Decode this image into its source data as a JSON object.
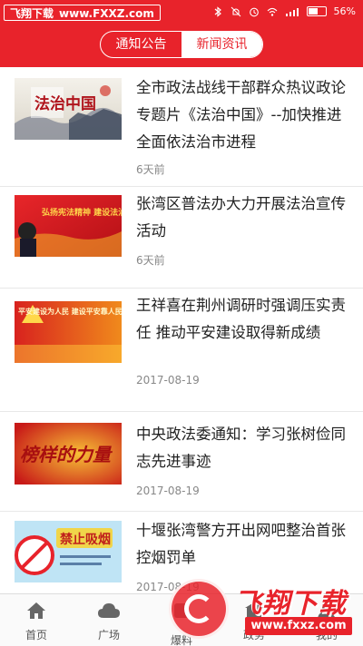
{
  "status_bar": {
    "watermark_brand": "飞翔下载",
    "watermark_url": "www.FXXZ.com",
    "battery": "56%",
    "battery_level": 0.56
  },
  "tabs": [
    {
      "label": "通知公告",
      "active": false
    },
    {
      "label": "新闻资讯",
      "active": true
    }
  ],
  "news": [
    {
      "title": "全市政法战线干部群众热议政论专题片《法治中国》--加快推进全面依法治市进程",
      "date": "6天前",
      "thumb_caption": "法治中国"
    },
    {
      "title": "张湾区普法办大力开展法治宣传活动",
      "date": "6天前",
      "thumb_caption": "弘扬宪法精神 建设法治中国"
    },
    {
      "title": "王祥喜在荆州调研时强调压实责任 推动平安建设取得新成绩",
      "date": "2017-08-19",
      "thumb_caption": "平安建设为人民 建设平安靠人民 平安成果"
    },
    {
      "title": "中央政法委通知：学习张树俭同志先进事迹",
      "date": "2017-08-19",
      "thumb_caption": "榜样的力量"
    },
    {
      "title": "十堰张湾警方开出网吧整治首张控烟罚单",
      "date": "2017-08-19",
      "thumb_caption": "禁止吸烟"
    }
  ],
  "bottom_nav": [
    {
      "label": "首页",
      "icon": "home-icon"
    },
    {
      "label": "广场",
      "icon": "cloud-icon"
    },
    {
      "label": "爆料",
      "icon": "report-icon"
    },
    {
      "label": "政务",
      "icon": "government-icon"
    },
    {
      "label": "我的",
      "icon": "profile-icon"
    }
  ],
  "watermark": {
    "brand": "飞翔下载",
    "url": "www.fxxz.com"
  },
  "colors": {
    "brand_red": "#e8232b"
  }
}
